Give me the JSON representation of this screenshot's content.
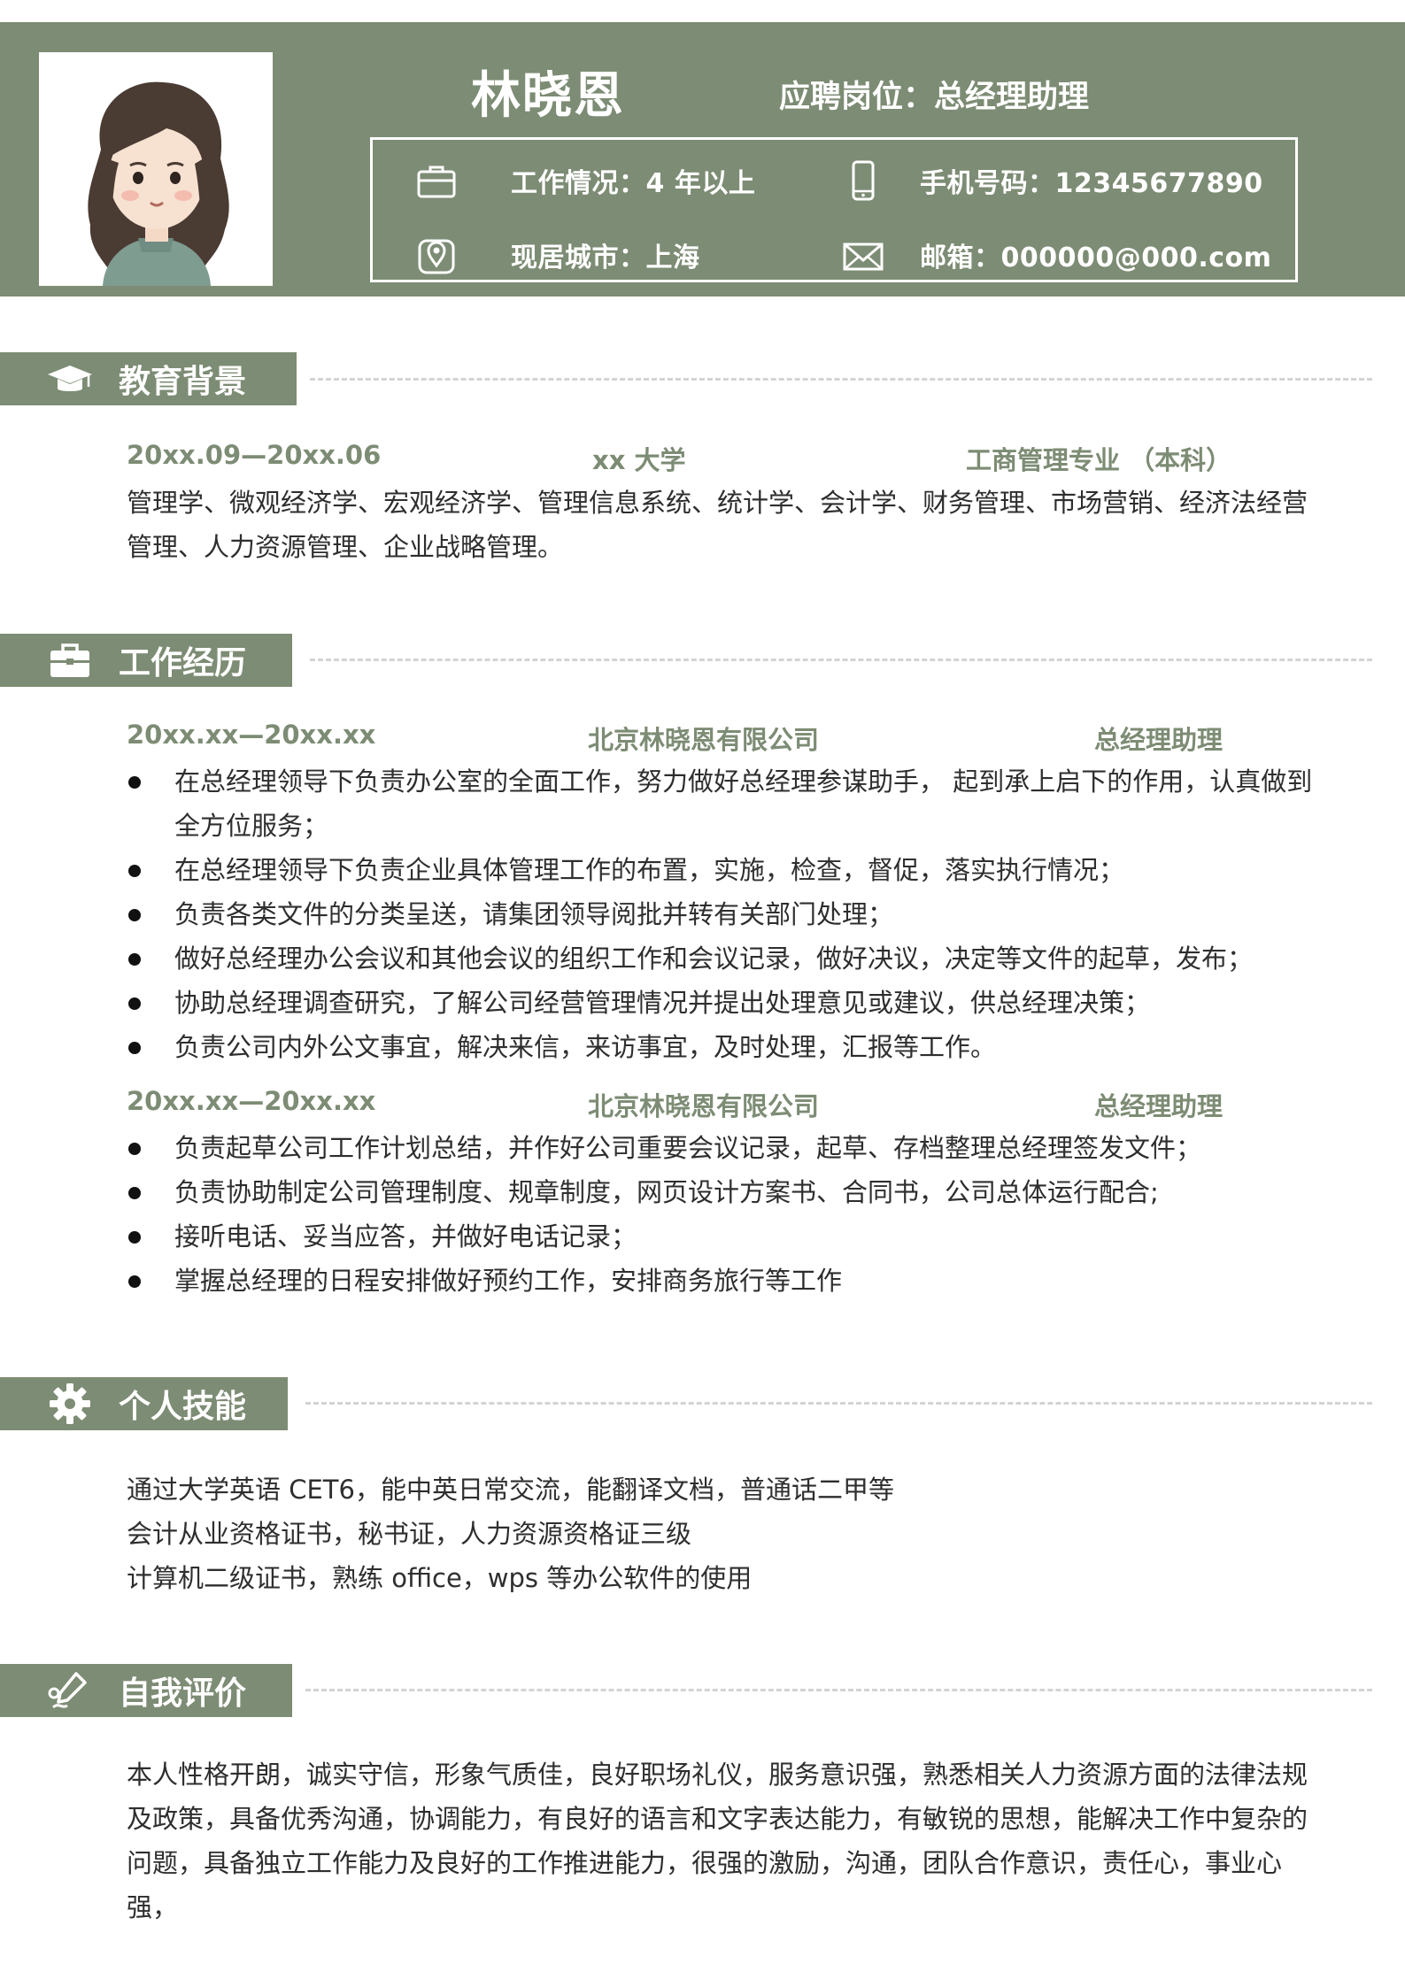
{
  "header": {
    "name": "林晓恩",
    "position": "应聘岗位：总经理助理",
    "work_status": "工作情况：4 年以上",
    "phone": "手机号码：12345677890",
    "city": "现居城市：上海",
    "email": "邮箱：000000@000.com"
  },
  "education": {
    "title": "教育背景",
    "period": "20xx.09—20xx.06",
    "school": "xx 大学",
    "major": "工商管理专业 （本科）",
    "courses": "管理学、微观经济学、宏观经济学、管理信息系统、统计学、会计学、财务管理、市场营销、经济法经营管理、人力资源管理、企业战略管理。"
  },
  "work": {
    "title": "工作经历",
    "jobs": [
      {
        "period": "20xx.xx—20xx.xx",
        "company": "北京林晓恩有限公司",
        "role": "总经理助理",
        "duties": [
          "在总经理领导下负责办公室的全面工作，努力做好总经理参谋助手， 起到承上启下的作用，认真做到全方位服务；",
          "在总经理领导下负责企业具体管理工作的布置，实施，检查，督促，落实执行情况；",
          "负责各类文件的分类呈送，请集团领导阅批并转有关部门处理；",
          "做好总经理办公会议和其他会议的组织工作和会议记录，做好决议，决定等文件的起草，发布；",
          "协助总经理调查研究，了解公司经营管理情况并提出处理意见或建议，供总经理决策；",
          "负责公司内外公文事宜，解决来信，来访事宜，及时处理，汇报等工作。"
        ]
      },
      {
        "period": "20xx.xx—20xx.xx",
        "company": "北京林晓恩有限公司",
        "role": "总经理助理",
        "duties": [
          "负责起草公司工作计划总结，并作好公司重要会议记录，起草、存档整理总经理签发文件；",
          "负责协助制定公司管理制度、规章制度，网页设计方案书、合同书，公司总体运行配合;",
          "接听电话、妥当应答，并做好电话记录；",
          "掌握总经理的日程安排做好预约工作，安排商务旅行等工作"
        ]
      }
    ]
  },
  "skills": {
    "title": "个人技能",
    "items": [
      "通过大学英语 CET6，能中英日常交流，能翻译文档，普通话二甲等",
      "会计从业资格证书，秘书证，人力资源资格证三级",
      "计算机二级证书，熟练 office，wps 等办公软件的使用"
    ]
  },
  "self_eval": {
    "title": "自我评价",
    "text": "本人性格开朗，诚实守信，形象气质佳，良好职场礼仪，服务意识强，熟悉相关人力资源方面的法律法规及政策，具备优秀沟通，协调能力，有良好的语言和文字表达能力，有敏锐的思想，能解决工作中复杂的问题，具备独立工作能力及良好的工作推进能力，很强的激励，沟通，团队合作意识，责任心，事业心强，"
  },
  "icons": {
    "avatar": "cartoon-girl-avatar",
    "work_status": "briefcase-icon",
    "phone": "mobile-phone-icon",
    "city": "location-pin-icon",
    "email": "envelope-icon",
    "education": "graduation-cap-icon",
    "work": "briefcase-icon",
    "skills": "gear-icon",
    "self_eval": "pen-icon"
  },
  "colors": {
    "accent": "#7d8c74",
    "text": "#2e2e2e",
    "dash": "#d3d3d3"
  }
}
